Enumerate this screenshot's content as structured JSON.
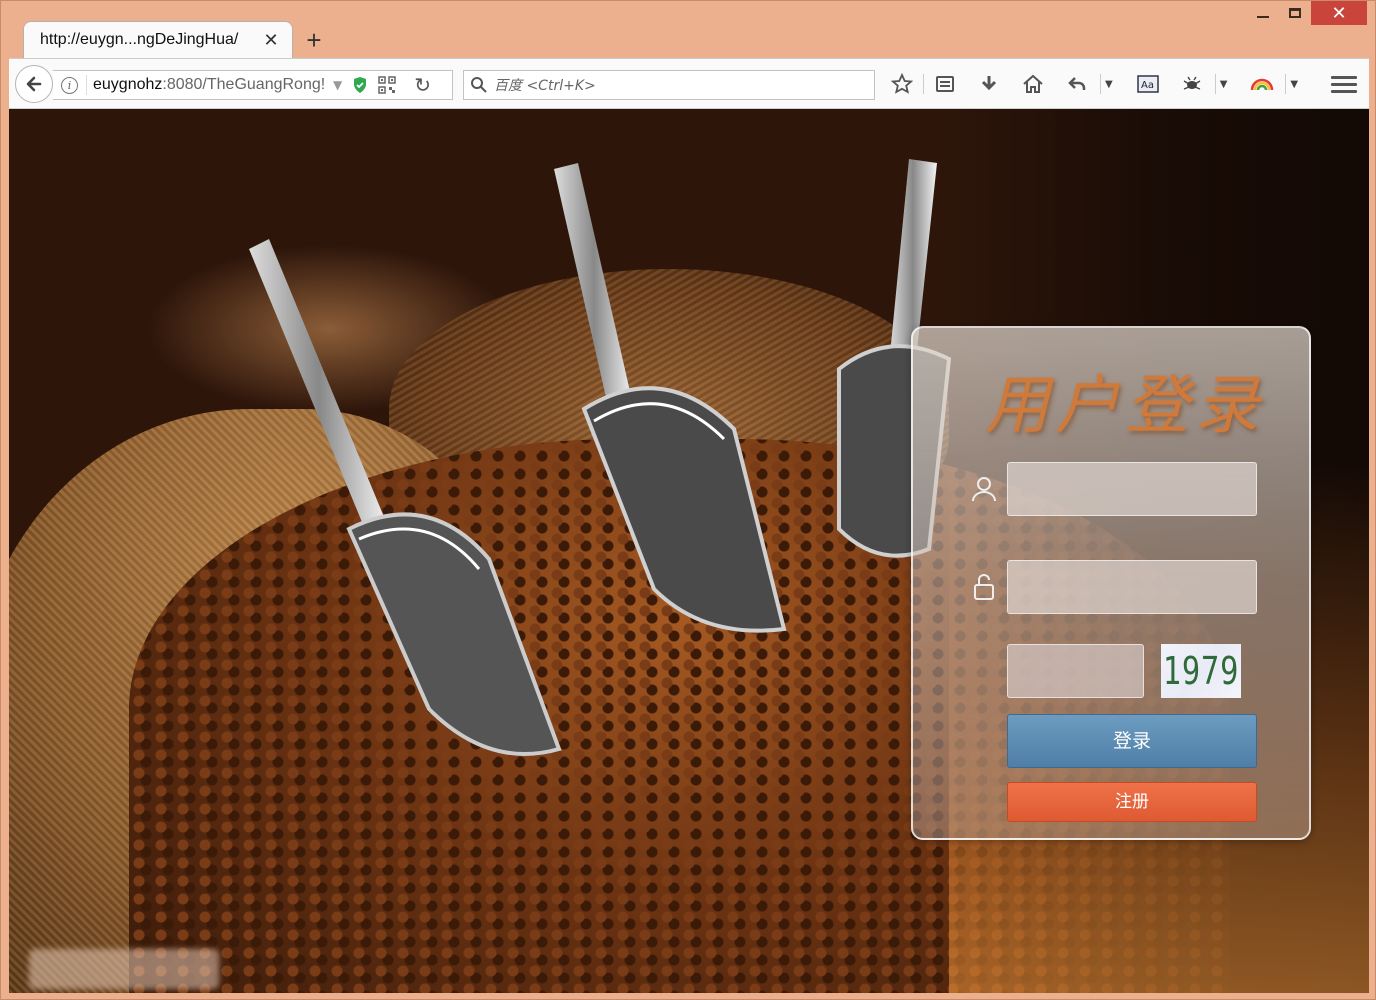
{
  "window": {
    "controls": {
      "minimize": "minimize",
      "maximize": "maximize",
      "close": "✕"
    }
  },
  "tab": {
    "title": "http://euygn...ngDeJingHua/",
    "close_label": "✕",
    "new_tab_label": "+"
  },
  "toolbar": {
    "url_host": "euygnohz",
    "url_rest": ":8080/TheGuangRong!",
    "search_placeholder": "百度 <Ctrl+K>",
    "icons": [
      "bookmark-star-icon",
      "reading-list-icon",
      "download-icon",
      "home-icon",
      "undo-icon",
      "reader-mode-icon",
      "screenshot-bug-icon",
      "rainbow-theme-icon",
      "menu-icon"
    ]
  },
  "login": {
    "title": "用户登录",
    "username_placeholder": "",
    "password_placeholder": "",
    "captcha_value": "1979",
    "login_button": "登录",
    "register_button": "注册"
  },
  "colors": {
    "frame": "#edb08f",
    "login_button": "#5b8ab3",
    "register_button": "#e4643c",
    "title": "#cf7a3a",
    "captcha_text": "#2f6b3a"
  }
}
